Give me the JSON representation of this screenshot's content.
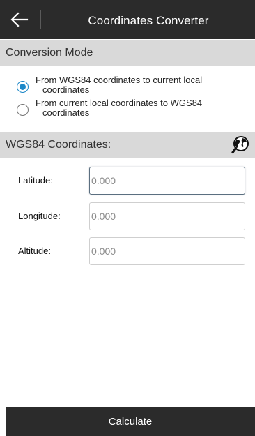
{
  "header": {
    "title": "Coordinates Converter",
    "back_icon": "arrow-left-icon"
  },
  "conversion_mode": {
    "title": "Conversion Mode",
    "options": [
      {
        "line1": "From WGS84 coordinates to current local",
        "line2": "coordinates",
        "checked": true
      },
      {
        "line1": "From current local coordinates to WGS84",
        "line2": "coordinates",
        "checked": false
      }
    ]
  },
  "wgs84": {
    "title": "WGS84 Coordinates:",
    "globe_icon": "globe-search-icon",
    "fields": [
      {
        "label": "Latitude:",
        "placeholder": "0.000"
      },
      {
        "label": "Longitude:",
        "placeholder": "0.000"
      },
      {
        "label": "Altitude:",
        "placeholder": "0.000"
      }
    ]
  },
  "footer": {
    "calculate_label": "Calculate"
  },
  "colors": {
    "bar": "#2b2b2b",
    "section": "#d9d9d9",
    "accent": "#1e88c8"
  }
}
